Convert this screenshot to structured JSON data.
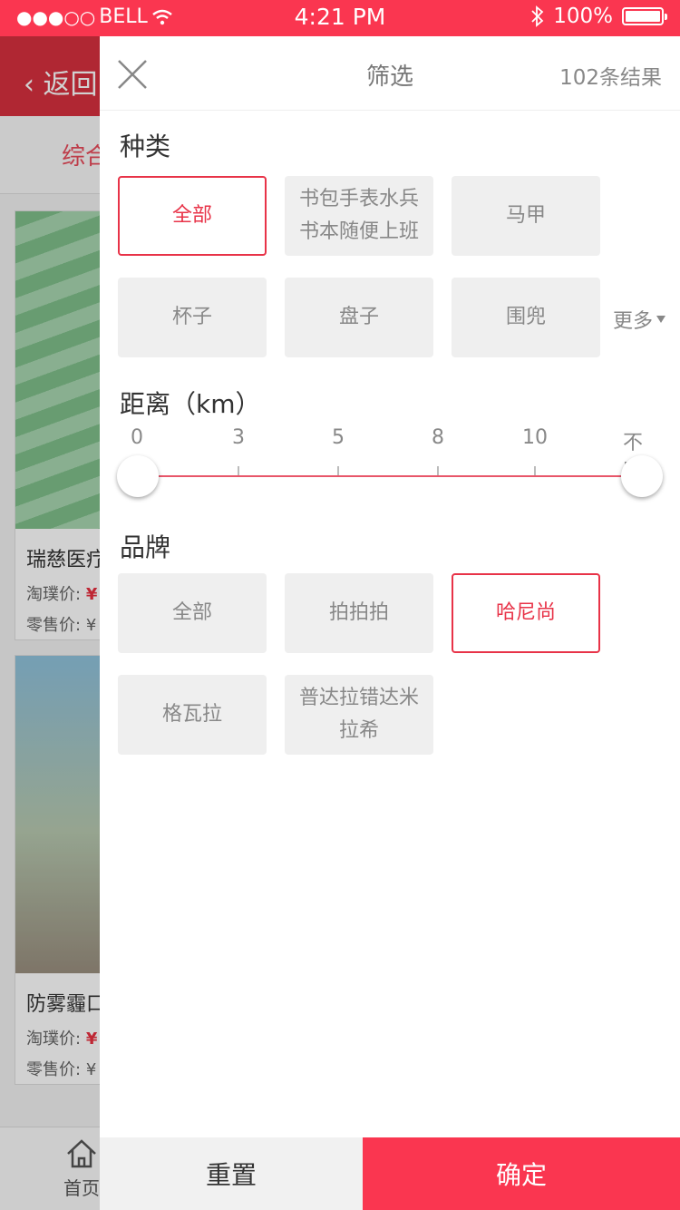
{
  "status_bar": {
    "carrier": "BELL",
    "time": "4:21 PM",
    "battery": "100%"
  },
  "background_page": {
    "back_label": "返回",
    "tab_label": "综合",
    "cards": [
      {
        "title": "瑞慈医疗",
        "member_price_label": "淘璞价:",
        "member_price": "¥",
        "retail_price_label": "零售价:",
        "retail_price": "¥"
      },
      {
        "title": "防雾霾口",
        "member_price_label": "淘璞价:",
        "member_price": "¥",
        "retail_price_label": "零售价:",
        "retail_price": "¥"
      }
    ],
    "tabbar_home": "首页"
  },
  "filter": {
    "title": "筛选",
    "result_count": "102条结果",
    "category": {
      "title": "种类",
      "options": [
        "全部",
        "书包手表水兵书本随便上班",
        "马甲",
        "杯子",
        "盘子",
        "围兜"
      ],
      "selected": "全部",
      "more_label": "更多"
    },
    "distance": {
      "title": "距离（km）",
      "ticks": [
        "0",
        "3",
        "5",
        "8",
        "10",
        "不限"
      ],
      "range_min": "0",
      "range_max": "不限"
    },
    "brand": {
      "title": "品牌",
      "options": [
        "全部",
        "拍拍拍",
        "哈尼尚",
        "格瓦拉",
        "普达拉错达米拉希"
      ],
      "selected": "哈尼尚"
    },
    "reset_label": "重置",
    "confirm_label": "确定"
  },
  "colors": {
    "accent": "#fa3650",
    "chip_bg": "#efefef",
    "selected_border": "#e83348"
  }
}
